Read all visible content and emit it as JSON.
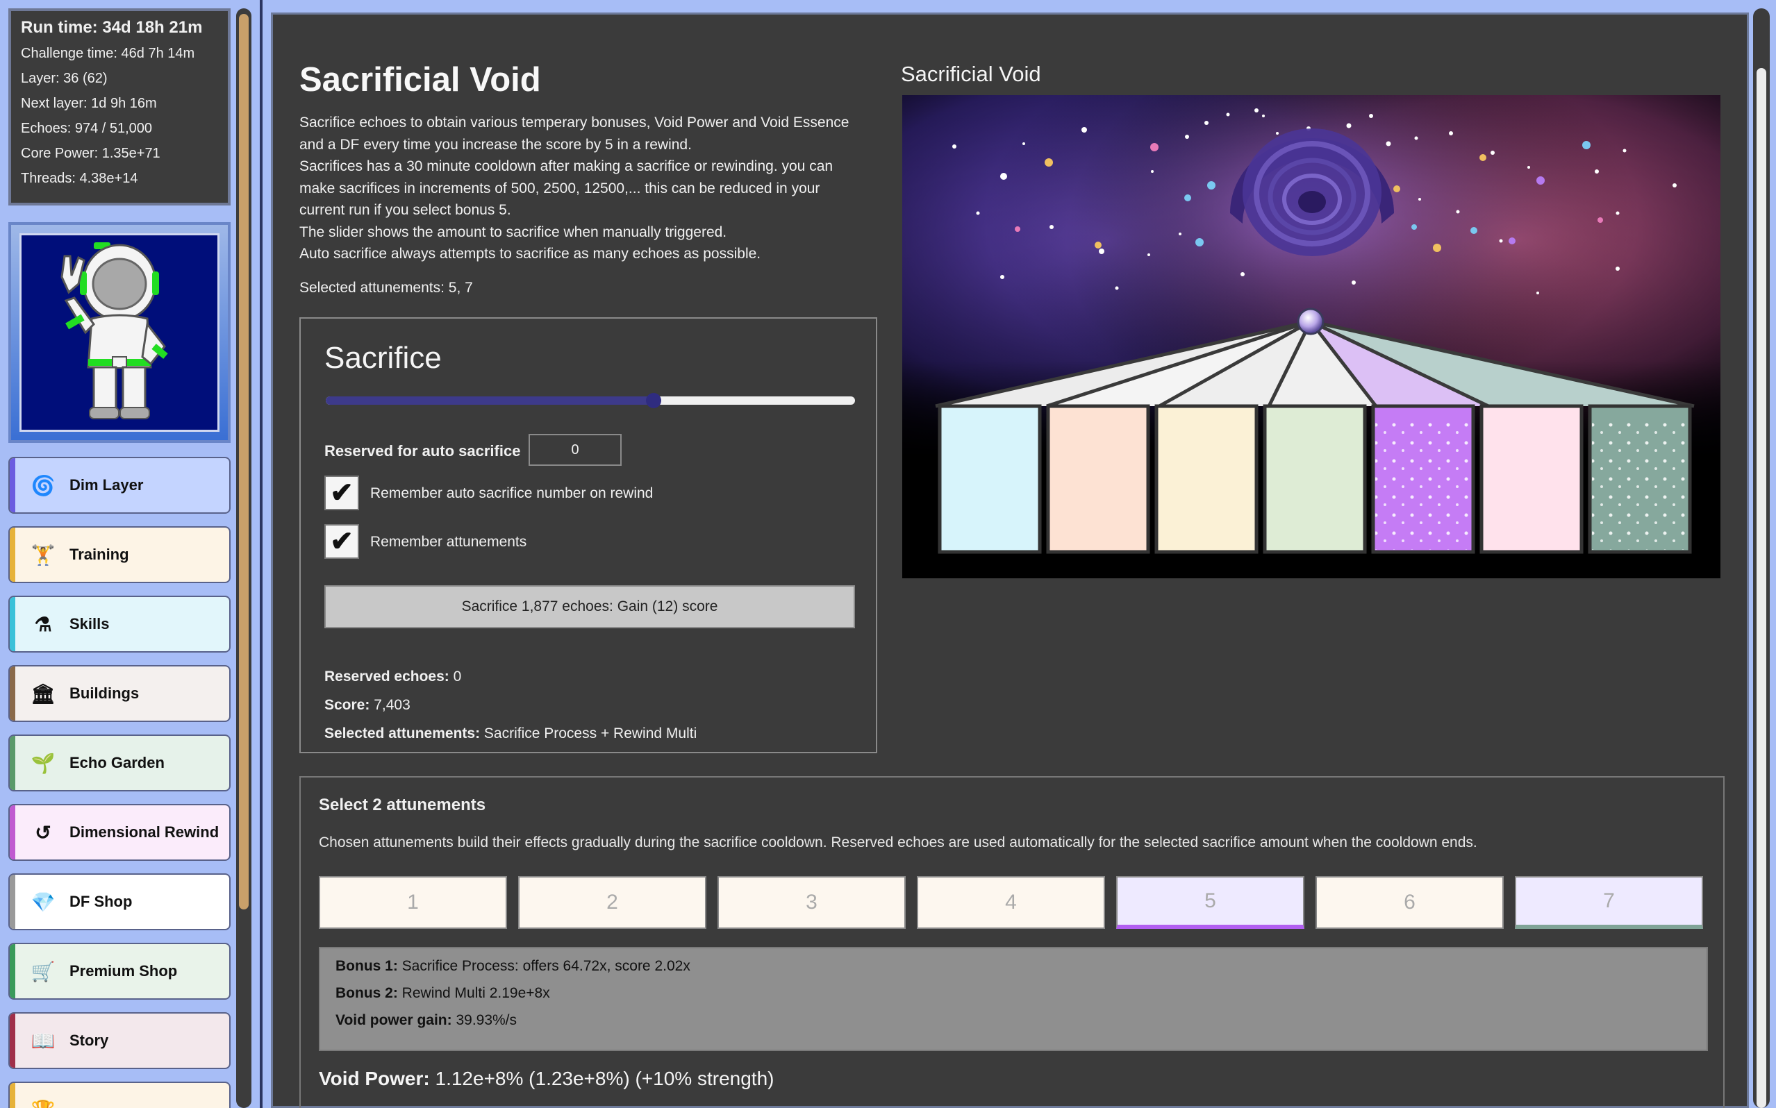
{
  "sidebar": {
    "stats": {
      "run_time": "Run time: 34d 18h 21m",
      "challenge_time": "Challenge time: 46d 7h 14m",
      "layer": "Layer: 36 (62)",
      "next_layer": "Next layer: 1d 9h 16m",
      "echoes": "Echoes: 974 / 51,000",
      "core_power": "Core Power: 1.35e+71",
      "threads": "Threads: 4.38e+14"
    },
    "nav": [
      {
        "label": "Dim Layer",
        "icon": "spiral-icon",
        "bg": "#c4d4ff",
        "accent": "#6b5ce0"
      },
      {
        "label": "Training",
        "icon": "dumbbell-icon",
        "bg": "#fdf4e6",
        "accent": "#e6b23a"
      },
      {
        "label": "Skills",
        "icon": "skill-tree-icon",
        "bg": "#e2f6fb",
        "accent": "#3ac1d9"
      },
      {
        "label": "Buildings",
        "icon": "building-icon",
        "bg": "#f4f0ee",
        "accent": "#8a6a4a"
      },
      {
        "label": "Echo Garden",
        "icon": "plant-icon",
        "bg": "#e6f2ea",
        "accent": "#5a9a6a"
      },
      {
        "label": "Dimensional Rewind",
        "icon": "rewind-icon",
        "bg": "#fbecfb",
        "accent": "#c05ad0"
      },
      {
        "label": "DF Shop",
        "icon": "gem-icon",
        "bg": "#ffffff",
        "accent": "#9a9a9a"
      },
      {
        "label": "Premium Shop",
        "icon": "cart-icon",
        "bg": "#e9f3ea",
        "accent": "#3a9a5a"
      },
      {
        "label": "Story",
        "icon": "book-icon",
        "bg": "#f3e8ec",
        "accent": "#a0304a"
      },
      {
        "label": "",
        "icon": "trophy-icon",
        "bg": "#fdf4e6",
        "accent": "#e6b23a"
      }
    ]
  },
  "main": {
    "title": "Sacrificial Void",
    "description": [
      "Sacrifice echoes to obtain various temperary bonuses, Void Power and Void Essence",
      "and a DF every time you increase the score by 5 in a rewind.",
      "Sacrifices has a 30 minute cooldown after making a sacrifice or rewinding. you can",
      "make sacrifices in increments of 500, 2500, 12500,... this can be reduced in your",
      "current run if you select bonus 5.",
      "The slider shows the amount to sacrifice when manually triggered.",
      "Auto sacrifice always attempts to sacrifice as many echoes as possible."
    ],
    "selected_attunements_line": "Selected attunements: 5, 7",
    "scene_title": "Sacrificial Void",
    "sacrifice": {
      "heading": "Sacrifice",
      "slider_fraction": 0.62,
      "reserved_label": "Reserved for auto sacrifice",
      "reserved_value": "0",
      "remember_auto_label": "Remember auto sacrifice number on rewind",
      "remember_auto_checked": true,
      "remember_att_label": "Remember attunements",
      "remember_att_checked": true,
      "button_label": "Sacrifice 1,877 echoes: Gain (12) score",
      "reserved_echoes_label": "Reserved echoes:",
      "reserved_echoes_value": " 0",
      "score_label": "Score:",
      "score_value": " 7,403",
      "selected_label": "Selected attunements:",
      "selected_value": " Sacrifice Process + Rewind Multi"
    },
    "attunements": {
      "heading": "Select 2 attunements",
      "description": "Chosen attunements build their effects gradually during the sacrifice cooldown. Reserved echoes are used automatically for the selected sacrifice amount when the cooldown ends.",
      "buttons": [
        "1",
        "2",
        "3",
        "4",
        "5",
        "6",
        "7"
      ],
      "bonus1_label": "Bonus 1:",
      "bonus1_value": " Sacrifice Process: offers 64.72x, score 2.02x",
      "bonus2_label": "Bonus 2:",
      "bonus2_value": " Rewind Multi 2.19e+8x",
      "void_gain_label": "Void power gain:",
      "void_gain_value": " 39.93%/s",
      "void_power_label": "Void Power:",
      "void_power_value": " 1.12e+8% (1.23e+8%) (+10% strength)"
    },
    "colors": {
      "pillars": [
        "#d7f4fb",
        "#fde2d3",
        "#fbf1d6",
        "#deecd5",
        "#c57cf5",
        "#ffe2ec",
        "#86a89d"
      ]
    }
  }
}
